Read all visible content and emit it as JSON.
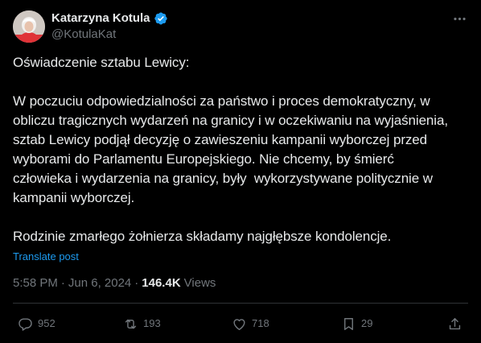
{
  "author": {
    "name": "Katarzyna Kotula",
    "handle": "@KotulaKat"
  },
  "tweet": {
    "text": "Oświadczenie sztabu Lewicy:\n\nW poczuciu odpowiedzialności za państwo i proces demokratyczny, w\nobliczu tragicznych wydarzeń na granicy i w oczekiwaniu na wyjaśnienia,\nsztab Lewicy podjął decyzję o zawieszeniu kampanii wyborczej przed\nwyborami do Parlamentu Europejskiego. Nie chcemy, by śmierć\nczłowieka i wydarzenia na granicy, były  wykorzystywane politycznie w\nkampanii wyborczej.\n\nRodzinie zmarłego żołnierza składamy najgłębsze kondolencje.",
    "translate_label": "Translate post"
  },
  "meta": {
    "time": "5:58 PM",
    "separator": "·",
    "date": "Jun 6, 2024",
    "views_count": "146.4K",
    "views_label": "Views"
  },
  "actions": {
    "replies": "952",
    "reposts": "193",
    "likes": "718",
    "bookmarks": "29"
  },
  "colors": {
    "background": "#000000",
    "text": "#e7e9ea",
    "secondary": "#71767b",
    "link": "#1d9bf0",
    "verified": "#1d9bf0",
    "divider": "#2f3336"
  }
}
